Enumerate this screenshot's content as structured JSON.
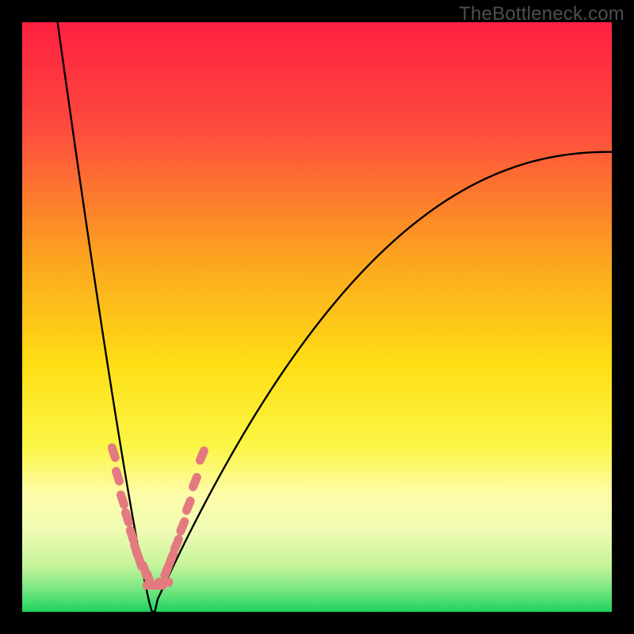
{
  "watermark": "TheBottleneck.com",
  "chart_data": {
    "type": "line",
    "title": "",
    "xlabel": "",
    "ylabel": "",
    "xlim": [
      0,
      100
    ],
    "ylim": [
      0,
      100
    ],
    "curve": {
      "description": "V-shaped bottleneck curve with vertex near x≈22, y≈0; left branch steep, right branch shallower hyperbola",
      "vertex_x": 22,
      "left_branch_top": {
        "x": 6,
        "y": 100
      },
      "right_branch_end": {
        "x": 100,
        "y": 78
      }
    },
    "highlight_band": {
      "description": "pale-yellow near-green band indicating acceptable bottleneck region",
      "top_pct": 75,
      "bottom_pct": 95
    },
    "green_zone": {
      "top_pct": 95,
      "bottom_pct": 100
    },
    "markers": {
      "color": "#e37a80",
      "groups": [
        {
          "side": "left",
          "points": [
            {
              "x": 15.5,
              "y": 73
            },
            {
              "x": 16.2,
              "y": 77
            },
            {
              "x": 17.0,
              "y": 81
            },
            {
              "x": 17.8,
              "y": 84
            },
            {
              "x": 18.6,
              "y": 87
            },
            {
              "x": 19.3,
              "y": 89.5
            },
            {
              "x": 20.0,
              "y": 91.5
            },
            {
              "x": 20.8,
              "y": 93
            },
            {
              "x": 21.5,
              "y": 94.5
            }
          ]
        },
        {
          "side": "right",
          "points": [
            {
              "x": 24.5,
              "y": 93
            },
            {
              "x": 25.3,
              "y": 91
            },
            {
              "x": 26.2,
              "y": 88.5
            },
            {
              "x": 27.2,
              "y": 85.5
            },
            {
              "x": 28.2,
              "y": 82
            },
            {
              "x": 29.3,
              "y": 78
            },
            {
              "x": 30.5,
              "y": 73.5
            }
          ]
        },
        {
          "side": "bottom",
          "points": [
            {
              "x": 22.0,
              "y": 95.5
            },
            {
              "x": 23.0,
              "y": 95.5
            },
            {
              "x": 24.0,
              "y": 95
            }
          ]
        }
      ]
    },
    "gradient_stops": [
      {
        "offset": 0,
        "color": "#fe2040"
      },
      {
        "offset": 0.18,
        "color": "#fd4b3e"
      },
      {
        "offset": 0.4,
        "color": "#fca41f"
      },
      {
        "offset": 0.58,
        "color": "#fede15"
      },
      {
        "offset": 0.72,
        "color": "#fbf646"
      },
      {
        "offset": 0.8,
        "color": "#fdfca9"
      },
      {
        "offset": 0.86,
        "color": "#f0fbb3"
      },
      {
        "offset": 0.92,
        "color": "#c7f49b"
      },
      {
        "offset": 0.96,
        "color": "#7de782"
      },
      {
        "offset": 1.0,
        "color": "#1fd35f"
      }
    ]
  }
}
